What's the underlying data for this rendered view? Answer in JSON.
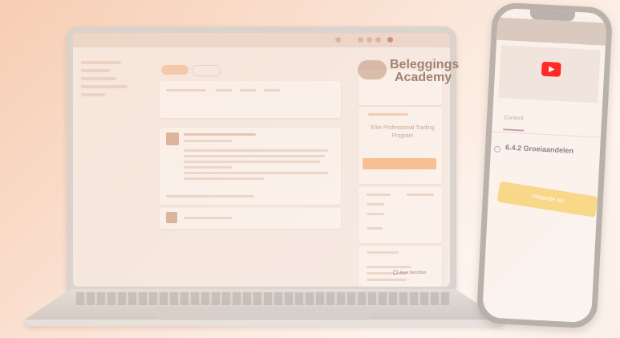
{
  "laptop": {
    "academy_line1": "Beleggings",
    "academy_line2": "Academy",
    "pro_title": "Elite Professional Trading Program",
    "chat_label": "Jouw berichten"
  },
  "phone": {
    "lesson_title": "6.4.2 Groeiaandelen",
    "tab_content": "Content",
    "cta": "Volgende les"
  }
}
